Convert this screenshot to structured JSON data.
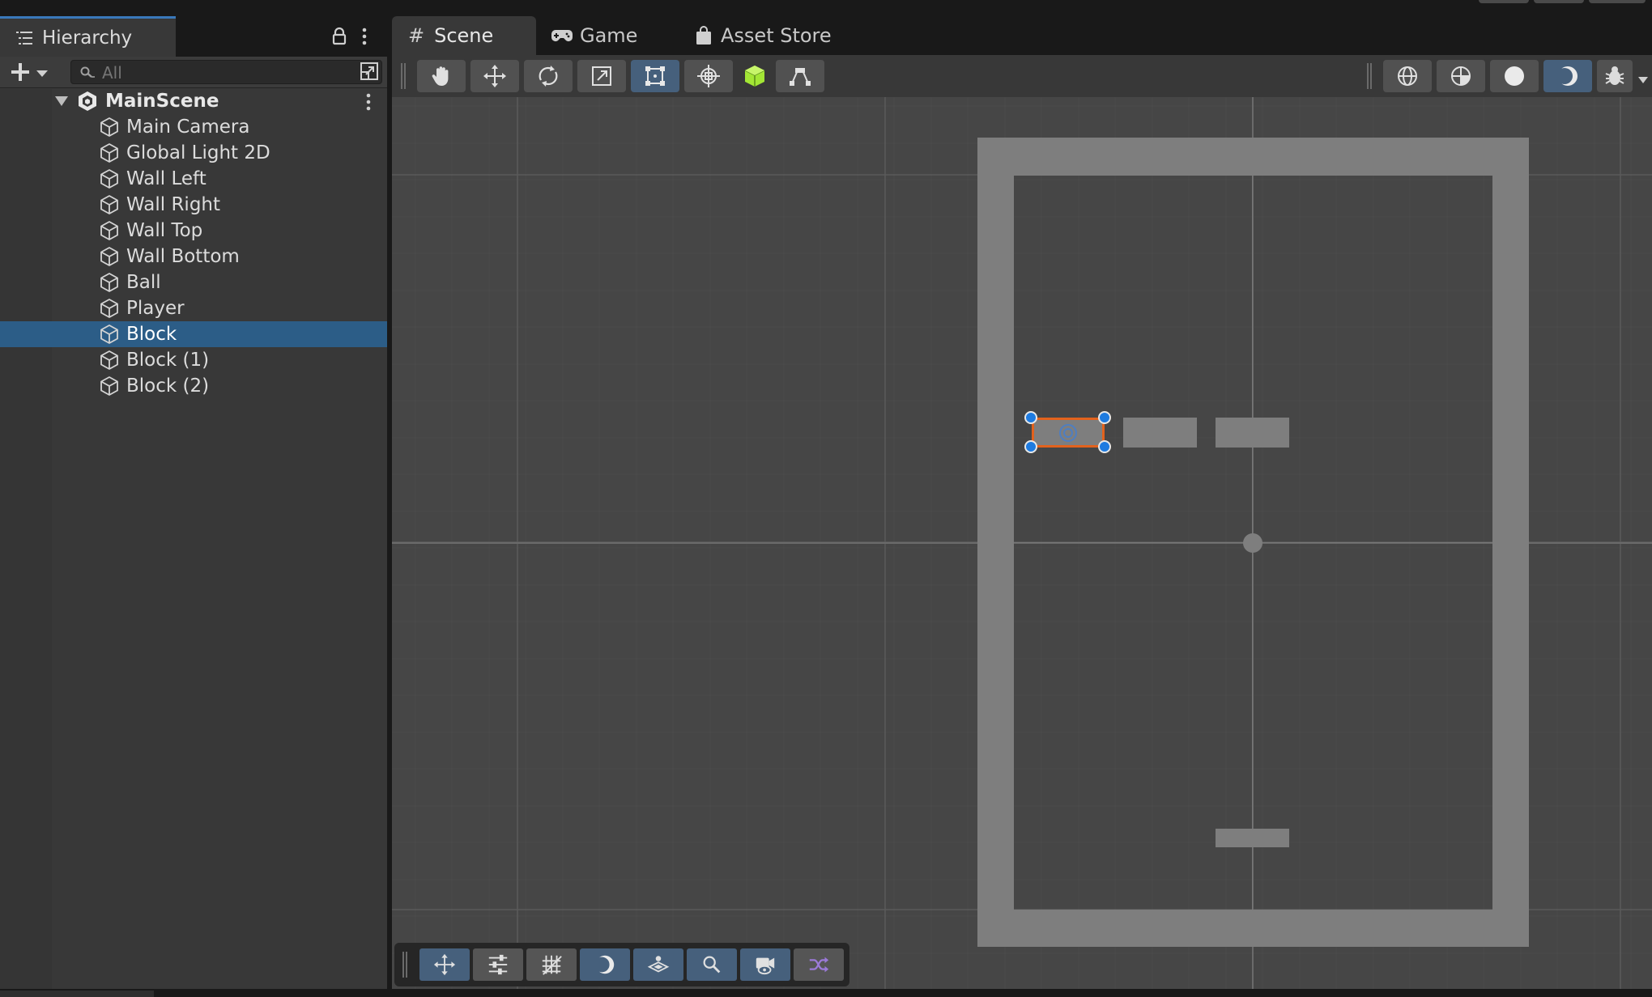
{
  "hierarchy": {
    "tab_label": "Hierarchy",
    "search_placeholder": "All",
    "scene_name": "MainScene",
    "items": [
      {
        "label": "Main Camera",
        "selected": false
      },
      {
        "label": "Global Light 2D",
        "selected": false
      },
      {
        "label": "Wall Left",
        "selected": false
      },
      {
        "label": "Wall Right",
        "selected": false
      },
      {
        "label": "Wall Top",
        "selected": false
      },
      {
        "label": "Wall Bottom",
        "selected": false
      },
      {
        "label": "Ball",
        "selected": false
      },
      {
        "label": "Player",
        "selected": false
      },
      {
        "label": "Block",
        "selected": true
      },
      {
        "label": "Block (1)",
        "selected": false
      },
      {
        "label": "Block (2)",
        "selected": false
      }
    ]
  },
  "tabs": [
    {
      "label": "Scene",
      "icon": "grid-hash-icon",
      "active": true
    },
    {
      "label": "Game",
      "icon": "gamepad-icon",
      "active": false
    },
    {
      "label": "Asset Store",
      "icon": "shopping-bag-icon",
      "active": false
    }
  ],
  "tools": [
    {
      "name": "hand-tool",
      "icon": "hand-icon",
      "active": false
    },
    {
      "name": "move-tool",
      "icon": "move-arrows-icon",
      "active": false
    },
    {
      "name": "rotate-tool",
      "icon": "rotate-icon",
      "active": false
    },
    {
      "name": "scale-tool",
      "icon": "scale-icon",
      "active": false
    },
    {
      "name": "rect-tool",
      "icon": "rect-transform-icon",
      "active": true
    },
    {
      "name": "transform-tool",
      "icon": "transform-icon",
      "active": false
    },
    {
      "name": "custom-tool",
      "icon": "green-cube-icon",
      "active": false
    },
    {
      "name": "path-tool",
      "icon": "path-editor-icon",
      "active": false
    }
  ],
  "colors": {
    "selection": "#2c5d87",
    "accent_blue": "#3a79bb",
    "toggle_on": "#46607c",
    "selection_outline": "#e2621d",
    "handle_blue": "#1e7be0",
    "wall_gray": "#7e7e7e",
    "grid_bg": "#464646",
    "green_cube": "#a3e635"
  }
}
